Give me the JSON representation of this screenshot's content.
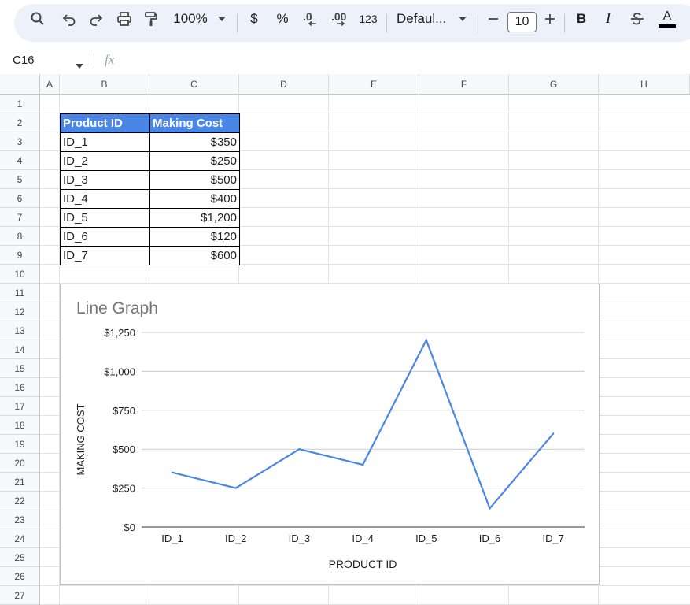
{
  "toolbar": {
    "zoom": "100%",
    "currency": "$",
    "percent": "%",
    "more_formats": "123",
    "font": "Defaul...",
    "font_size": "10",
    "bold": "B",
    "italic": "I",
    "text_color": "A"
  },
  "formula_bar": {
    "cell_ref": "C16",
    "fx": "fx",
    "formula": ""
  },
  "columns": [
    "A",
    "B",
    "C",
    "D",
    "E",
    "F",
    "G",
    "H"
  ],
  "rows": [
    "1",
    "2",
    "3",
    "4",
    "5",
    "6",
    "7",
    "8",
    "9",
    "10",
    "11",
    "12",
    "13",
    "14",
    "15",
    "16",
    "17",
    "18",
    "19",
    "20",
    "21",
    "22",
    "23",
    "24",
    "25",
    "26",
    "27"
  ],
  "table": {
    "header": [
      "Product ID",
      "Making Cost"
    ],
    "rows": [
      [
        "ID_1",
        "$350"
      ],
      [
        "ID_2",
        "$250"
      ],
      [
        "ID_3",
        "$500"
      ],
      [
        "ID_4",
        "$400"
      ],
      [
        "ID_5",
        "$1,200"
      ],
      [
        "ID_6",
        "$120"
      ],
      [
        "ID_7",
        "$600"
      ]
    ]
  },
  "colors": {
    "header_fill": "#4a86e8",
    "series": "#4a86e8"
  },
  "chart_data": {
    "type": "line",
    "title": "Line Graph",
    "xlabel": "PRODUCT ID",
    "ylabel": "MAKING COST",
    "categories": [
      "ID_1",
      "ID_2",
      "ID_3",
      "ID_4",
      "ID_5",
      "ID_6",
      "ID_7"
    ],
    "values": [
      350,
      250,
      500,
      400,
      1200,
      120,
      600
    ],
    "ylim": [
      0,
      1250
    ],
    "yticks": [
      0,
      250,
      500,
      750,
      1000,
      1250
    ],
    "ytick_labels": [
      "$0",
      "$250",
      "$500",
      "$750",
      "$1,000",
      "$1,250"
    ],
    "grid": true,
    "legend": "none"
  }
}
